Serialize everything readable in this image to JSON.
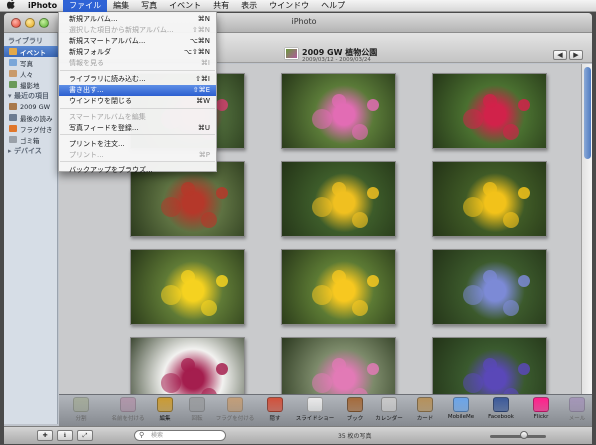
{
  "menubar": {
    "apple": "",
    "items": [
      "iPhoto",
      "ファイル",
      "編集",
      "写真",
      "イベント",
      "共有",
      "表示",
      "ウインドウ",
      "ヘルプ"
    ],
    "active_index": 1
  },
  "window": {
    "title": "iPhoto"
  },
  "sidebar": {
    "library_heading": "ライブラリ",
    "library_items": [
      "イベント",
      "写真",
      "人々",
      "撮影地"
    ],
    "recent_heading": "最近の項目",
    "recent_items": [
      "2009 GW",
      "最後の読み",
      "フラグ付き",
      "ゴミ箱"
    ],
    "devices_heading": "デバイス"
  },
  "event": {
    "title": "2009 GW 植物公園",
    "dates": "2009/03/12 - 2009/03/24"
  },
  "file_menu": {
    "items": [
      {
        "label": "新規アルバム...",
        "shortcut": "⌘N",
        "disabled": false
      },
      {
        "label": "選択した項目から新規アルバム...",
        "shortcut": "⇧⌘N",
        "disabled": true
      },
      {
        "label": "新規スマートアルバム...",
        "shortcut": "⌥⌘N",
        "disabled": false
      },
      {
        "label": "新規フォルダ",
        "shortcut": "⌥⇧⌘N",
        "disabled": false
      },
      {
        "label": "情報を見る",
        "shortcut": "⌘I",
        "disabled": true
      },
      {
        "label": "ライブラリに読み込む...",
        "shortcut": "⇧⌘I",
        "disabled": false
      },
      {
        "label": "書き出す...",
        "shortcut": "⇧⌘E",
        "disabled": false,
        "highlighted": true
      },
      {
        "label": "ウインドウを閉じる",
        "shortcut": "⌘W",
        "disabled": false
      },
      {
        "label": "スマートアルバムを編集",
        "shortcut": "",
        "disabled": true
      },
      {
        "label": "写真フィードを登録...",
        "shortcut": "⌘U",
        "disabled": false
      },
      {
        "label": "プリントを注文...",
        "shortcut": "",
        "disabled": false
      },
      {
        "label": "プリント...",
        "shortcut": "⌘P",
        "disabled": true
      },
      {
        "label": "バックアップをブラウズ...",
        "shortcut": "",
        "disabled": false
      }
    ]
  },
  "photos": [
    {
      "subject": "pink-flowers",
      "bg": "#4e6a3a",
      "accent": "#d23f6e"
    },
    {
      "subject": "cosmos-pink",
      "bg": "#5a7a38",
      "accent": "#e26cb4"
    },
    {
      "subject": "red-flowers",
      "bg": "#4a7030",
      "accent": "#d1224a"
    },
    {
      "subject": "red-foliage",
      "bg": "#5e7242",
      "accent": "#b5382a"
    },
    {
      "subject": "yellow-flowers",
      "bg": "#3d5c2a",
      "accent": "#f0c020"
    },
    {
      "subject": "black-eyed-susan",
      "bg": "#3f5a26",
      "accent": "#f2c21a"
    },
    {
      "subject": "marigolds",
      "bg": "#5f7a36",
      "accent": "#f5d220"
    },
    {
      "subject": "marigolds",
      "bg": "#5c7a34",
      "accent": "#f7c820"
    },
    {
      "subject": "hydrangea",
      "bg": "#3c5a2c",
      "accent": "#7c8ad6"
    },
    {
      "subject": "red-flowers",
      "bg": "#f2f2f0",
      "accent": "#a41e4e"
    },
    {
      "subject": "pink-flowers",
      "bg": "#7c8a6a",
      "accent": "#e27ab6"
    },
    {
      "subject": "purple-irises",
      "bg": "#3a5a2e",
      "accent": "#5a48b8"
    }
  ],
  "toolbar": {
    "items": [
      {
        "label": "分割",
        "icon": "split-icon",
        "color": "#9aa47e",
        "disabled": true
      },
      {
        "label": "名前を付ける",
        "icon": "tag-icon",
        "color": "#b27a9c",
        "disabled": true
      },
      {
        "label": "編集",
        "icon": "pencil-icon",
        "color": "#c99a32",
        "disabled": false
      },
      {
        "label": "回転",
        "icon": "rotate-icon",
        "color": "#8a8a8a",
        "disabled": true
      },
      {
        "label": "フラグを付ける",
        "icon": "flag-icon",
        "color": "#d68a3a",
        "disabled": true
      },
      {
        "label": "隠す",
        "icon": "hide-icon",
        "color": "#d0503a",
        "disabled": false
      },
      {
        "label": "スライドショー",
        "icon": "play-icon",
        "color": "#e8e8e8",
        "disabled": false
      },
      {
        "label": "ブック",
        "icon": "book-icon",
        "color": "#a46a3a",
        "disabled": false
      },
      {
        "label": "カレンダー",
        "icon": "calendar-icon",
        "color": "#c8c8c8",
        "disabled": false
      },
      {
        "label": "カード",
        "icon": "card-icon",
        "color": "#b4905a",
        "disabled": false
      },
      {
        "label": "MobileMe",
        "icon": "cloud-icon",
        "color": "#6aa4e8",
        "disabled": false
      },
      {
        "label": "Facebook",
        "icon": "facebook-icon",
        "color": "#3b5998",
        "disabled": false
      },
      {
        "label": "Flickr",
        "icon": "flickr-icon",
        "color": "#ff1f8a",
        "disabled": false
      },
      {
        "label": "メール",
        "icon": "mail-icon",
        "color": "#9a7ab8",
        "disabled": true
      }
    ]
  },
  "statusbar": {
    "search_placeholder": "検索",
    "photo_count": "35 枚の写真",
    "zoom_level": 0.6
  },
  "colors": {
    "selection": "#2f63d6",
    "sidebar_bg": "#d6dde6",
    "content_bg": "#c9cacc"
  }
}
